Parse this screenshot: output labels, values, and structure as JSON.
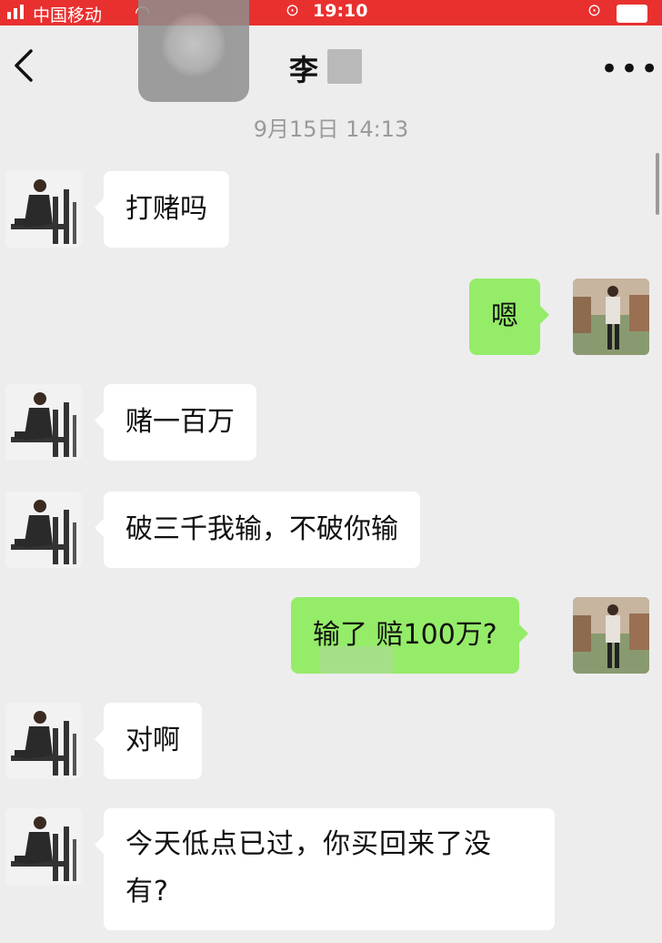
{
  "status_bar": {
    "carrier": "中国移动",
    "time": "19:10"
  },
  "header": {
    "title": "李"
  },
  "timestamp": "9月15日 14:13",
  "messages": [
    {
      "side": "in",
      "text": "打赌吗"
    },
    {
      "side": "out",
      "text": "嗯"
    },
    {
      "side": "in",
      "text": "赌一百万"
    },
    {
      "side": "in",
      "text": "破三千我输，不破你输"
    },
    {
      "side": "out",
      "text": "输了 赔100万?"
    },
    {
      "side": "in",
      "text": "对啊"
    },
    {
      "side": "in",
      "text": "今天低点已过，你买回来了没有?"
    }
  ],
  "colors": {
    "status_bar": "#e8302f",
    "background": "#ededed",
    "incoming_bubble": "#ffffff",
    "outgoing_bubble": "#95ec69"
  }
}
